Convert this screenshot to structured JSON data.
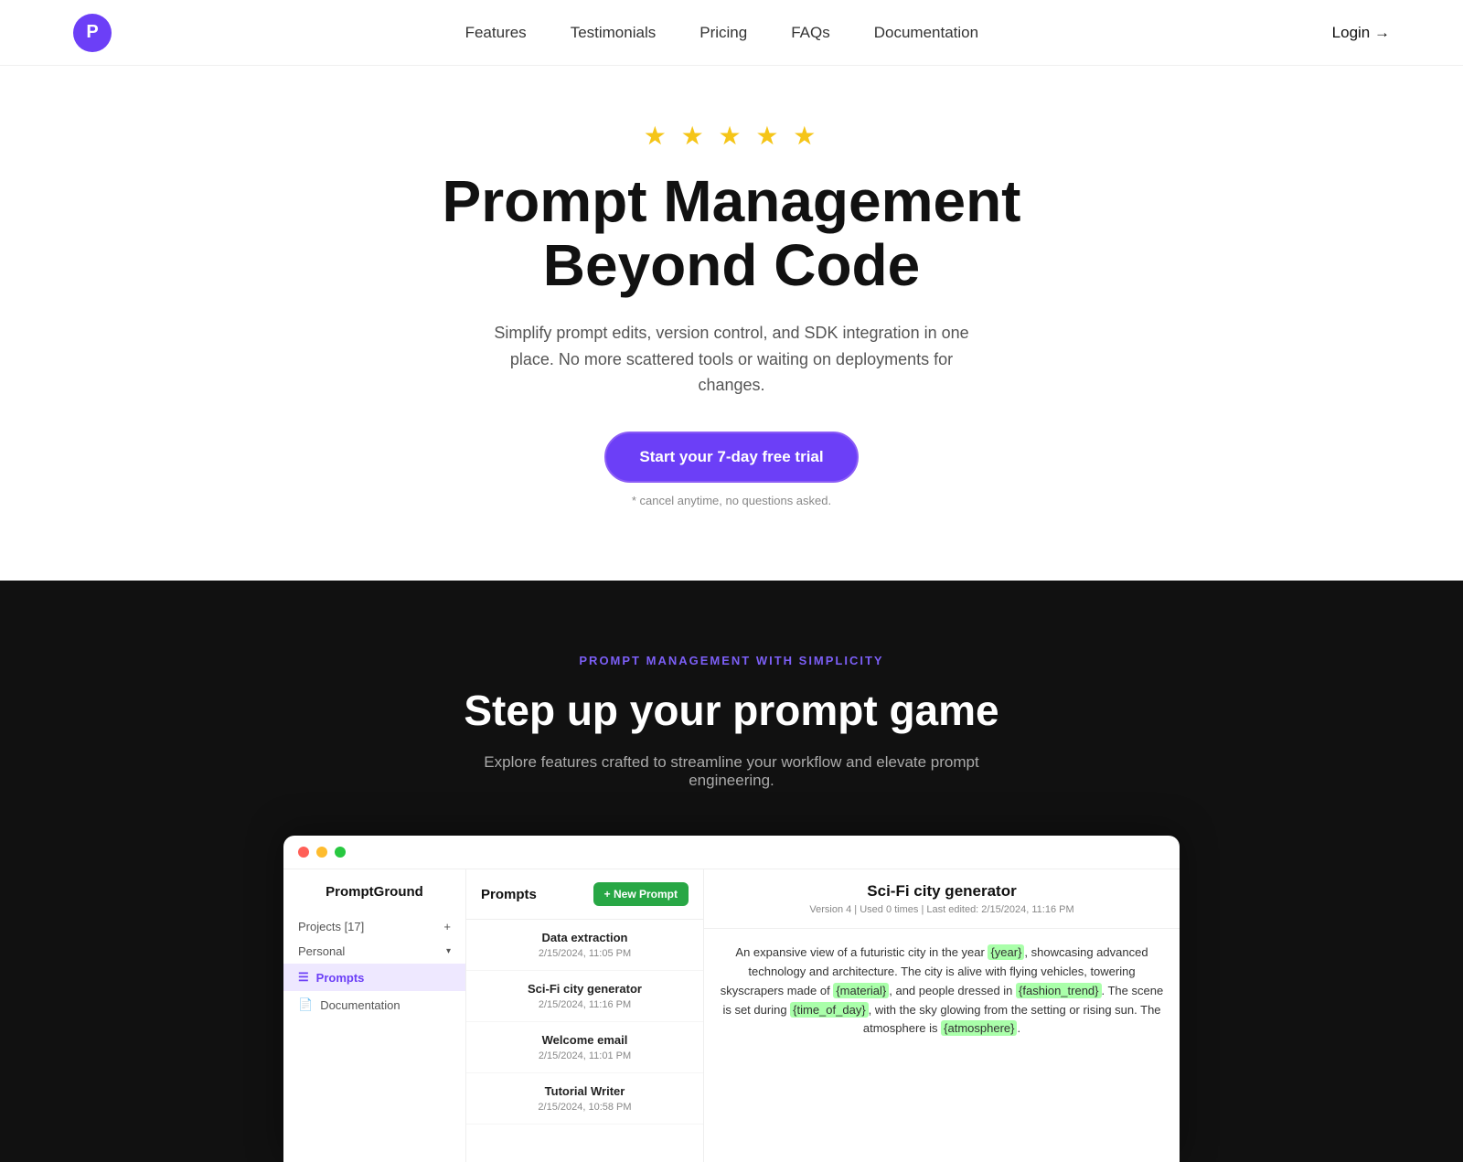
{
  "navbar": {
    "logo_letter": "P",
    "links": [
      {
        "label": "Features",
        "href": "#"
      },
      {
        "label": "Testimonials",
        "href": "#"
      },
      {
        "label": "Pricing",
        "href": "#"
      },
      {
        "label": "FAQs",
        "href": "#"
      },
      {
        "label": "Documentation",
        "href": "#"
      }
    ],
    "login_label": "Login →"
  },
  "hero": {
    "stars": "★ ★ ★ ★ ★",
    "title_line1": "Prompt Management",
    "title_line2": "Beyond Code",
    "subtitle": "Simplify prompt edits, version control, and SDK integration in one place. No more scattered tools or waiting on deployments for changes.",
    "cta_label": "Start your 7-day free trial",
    "cta_note": "* cancel anytime, no questions asked."
  },
  "dark_section": {
    "label": "PROMPT MANAGEMENT WITH SIMPLICITY",
    "title": "Step up your prompt game",
    "description": "Explore features crafted to streamline your workflow and elevate prompt engineering."
  },
  "app": {
    "brand": "PromptGround",
    "sidebar": {
      "projects_label": "Projects [17]",
      "personal_label": "Personal",
      "prompts_label": "Prompts",
      "documentation_label": "Documentation"
    },
    "prompts_header": "Prompts",
    "new_prompt_btn": "+ New Prompt",
    "prompt_items": [
      {
        "name": "Data extraction",
        "date": "2/15/2024, 11:05 PM"
      },
      {
        "name": "Sci-Fi city generator",
        "date": "2/15/2024, 11:16 PM"
      },
      {
        "name": "Welcome email",
        "date": "2/15/2024, 11:01 PM"
      },
      {
        "name": "Tutorial Writer",
        "date": "2/15/2024, 10:58 PM"
      }
    ],
    "content": {
      "title": "Sci-Fi city generator",
      "meta": "Version 4 | Used 0 times | Last edited: 2/15/2024, 11:16 PM",
      "text_before_year": "An expansive view of a futuristic city in the year ",
      "highlight_year": "{year}",
      "text_after_year": ", showcasing advanced technology and architecture. The city is alive with flying vehicles, towering skyscrapers made of ",
      "highlight_material": "{material}",
      "text_after_material": ", and people dressed in ",
      "highlight_fashion": "{fashion_trend}",
      "text_after_fashion": ". The scene is set during ",
      "highlight_time": "{time_of_day}",
      "text_after_time": ", with the sky glowing from the setting or rising sun. The atmosphere is ",
      "highlight_atmosphere": "{atmosphere}",
      "text_end": "."
    }
  }
}
